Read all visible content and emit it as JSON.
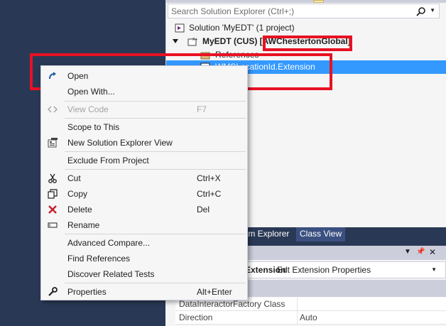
{
  "solution_explorer": {
    "search_placeholder": "Search Solution Explorer (Ctrl+;)",
    "tree": {
      "solution": "Solution 'MyEDT' (1 project)",
      "project": "MyEDT (CUS) [AWChestertonGlobal]",
      "references": "References",
      "item": "WMSLocationId.Extension"
    }
  },
  "tabs": {
    "team_explorer": "Team Explorer",
    "class_view": "Class View"
  },
  "properties": {
    "selected_name": "Extension",
    "selected_type": "Edt Extension Properties",
    "rows": [
      {
        "key": "DataInteractorFactory Class",
        "value": ""
      },
      {
        "key": "Direction",
        "value": "Auto"
      }
    ]
  },
  "context_menu": {
    "items": {
      "open": {
        "label": "Open",
        "shortcut": ""
      },
      "open_with": {
        "label": "Open With...",
        "shortcut": ""
      },
      "view_code": {
        "label": "View Code",
        "shortcut": "F7"
      },
      "scope_to_this": {
        "label": "Scope to This",
        "shortcut": ""
      },
      "new_se_view": {
        "label": "New Solution Explorer View",
        "shortcut": ""
      },
      "exclude": {
        "label": "Exclude From Project",
        "shortcut": ""
      },
      "cut": {
        "label": "Cut",
        "shortcut": "Ctrl+X"
      },
      "copy": {
        "label": "Copy",
        "shortcut": "Ctrl+C"
      },
      "delete": {
        "label": "Delete",
        "shortcut": "Del"
      },
      "rename": {
        "label": "Rename",
        "shortcut": ""
      },
      "advanced_compare": {
        "label": "Advanced Compare...",
        "shortcut": ""
      },
      "find_references": {
        "label": "Find References",
        "shortcut": ""
      },
      "discover_tests": {
        "label": "Discover Related Tests",
        "shortcut": ""
      },
      "properties": {
        "label": "Properties",
        "shortcut": "Alt+Enter"
      }
    }
  },
  "colors": {
    "selection": "#3399ff",
    "highlight_box": "#e81123",
    "ide_background": "#293955"
  }
}
